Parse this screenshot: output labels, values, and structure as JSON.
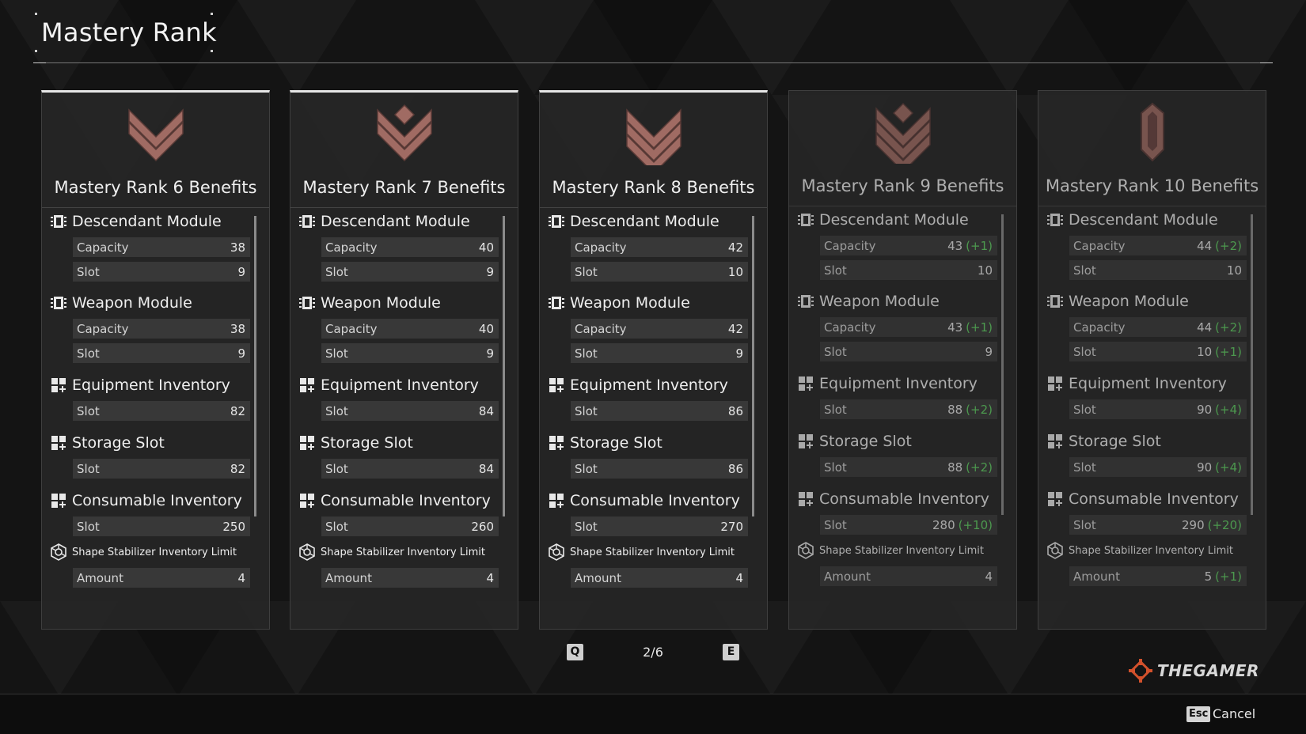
{
  "page": {
    "title": "Mastery Rank",
    "colors": {
      "background": "#141414",
      "card": "#262626",
      "stat_row": "#383838",
      "bonus_green": "#5fcf62",
      "emblem_copper": "#a06b63"
    }
  },
  "cards": [
    {
      "title": "Mastery Rank 6 Benefits",
      "emblem": "rank-6-chevron-emblem",
      "current": true,
      "locked": false,
      "sections": [
        {
          "title": "Descendant Module",
          "icon": "module-icon",
          "rows": [
            {
              "label": "Capacity",
              "value": "38",
              "bonus": ""
            },
            {
              "label": "Slot",
              "value": "9",
              "bonus": ""
            }
          ]
        },
        {
          "title": "Weapon Module",
          "icon": "module-icon",
          "rows": [
            {
              "label": "Capacity",
              "value": "38",
              "bonus": ""
            },
            {
              "label": "Slot",
              "value": "9",
              "bonus": ""
            }
          ]
        },
        {
          "title": "Equipment Inventory",
          "icon": "inventory-icon",
          "rows": [
            {
              "label": "Slot",
              "value": "82",
              "bonus": ""
            }
          ]
        },
        {
          "title": "Storage Slot",
          "icon": "inventory-icon",
          "rows": [
            {
              "label": "Slot",
              "value": "82",
              "bonus": ""
            }
          ]
        },
        {
          "title": "Consumable Inventory",
          "icon": "inventory-icon",
          "rows": [
            {
              "label": "Slot",
              "value": "250",
              "bonus": ""
            }
          ]
        },
        {
          "title": "Shape Stabilizer Inventory Limit",
          "icon": "stabilizer-icon",
          "rows": [
            {
              "label": "Amount",
              "value": "4",
              "bonus": ""
            }
          ]
        }
      ]
    },
    {
      "title": "Mastery Rank 7 Benefits",
      "emblem": "rank-7-chevron-emblem",
      "current": true,
      "locked": false,
      "sections": [
        {
          "title": "Descendant Module",
          "icon": "module-icon",
          "rows": [
            {
              "label": "Capacity",
              "value": "40",
              "bonus": ""
            },
            {
              "label": "Slot",
              "value": "9",
              "bonus": ""
            }
          ]
        },
        {
          "title": "Weapon Module",
          "icon": "module-icon",
          "rows": [
            {
              "label": "Capacity",
              "value": "40",
              "bonus": ""
            },
            {
              "label": "Slot",
              "value": "9",
              "bonus": ""
            }
          ]
        },
        {
          "title": "Equipment Inventory",
          "icon": "inventory-icon",
          "rows": [
            {
              "label": "Slot",
              "value": "84",
              "bonus": ""
            }
          ]
        },
        {
          "title": "Storage Slot",
          "icon": "inventory-icon",
          "rows": [
            {
              "label": "Slot",
              "value": "84",
              "bonus": ""
            }
          ]
        },
        {
          "title": "Consumable Inventory",
          "icon": "inventory-icon",
          "rows": [
            {
              "label": "Slot",
              "value": "260",
              "bonus": ""
            }
          ]
        },
        {
          "title": "Shape Stabilizer Inventory Limit",
          "icon": "stabilizer-icon",
          "rows": [
            {
              "label": "Amount",
              "value": "4",
              "bonus": ""
            }
          ]
        }
      ]
    },
    {
      "title": "Mastery Rank 8 Benefits",
      "emblem": "rank-8-chevron-emblem",
      "current": true,
      "locked": false,
      "sections": [
        {
          "title": "Descendant Module",
          "icon": "module-icon",
          "rows": [
            {
              "label": "Capacity",
              "value": "42",
              "bonus": ""
            },
            {
              "label": "Slot",
              "value": "10",
              "bonus": ""
            }
          ]
        },
        {
          "title": "Weapon Module",
          "icon": "module-icon",
          "rows": [
            {
              "label": "Capacity",
              "value": "42",
              "bonus": ""
            },
            {
              "label": "Slot",
              "value": "9",
              "bonus": ""
            }
          ]
        },
        {
          "title": "Equipment Inventory",
          "icon": "inventory-icon",
          "rows": [
            {
              "label": "Slot",
              "value": "86",
              "bonus": ""
            }
          ]
        },
        {
          "title": "Storage Slot",
          "icon": "inventory-icon",
          "rows": [
            {
              "label": "Slot",
              "value": "86",
              "bonus": ""
            }
          ]
        },
        {
          "title": "Consumable Inventory",
          "icon": "inventory-icon",
          "rows": [
            {
              "label": "Slot",
              "value": "270",
              "bonus": ""
            }
          ]
        },
        {
          "title": "Shape Stabilizer Inventory Limit",
          "icon": "stabilizer-icon",
          "rows": [
            {
              "label": "Amount",
              "value": "4",
              "bonus": ""
            }
          ]
        }
      ]
    },
    {
      "title": "Mastery Rank 9 Benefits",
      "emblem": "rank-9-chevron-emblem",
      "current": false,
      "locked": true,
      "sections": [
        {
          "title": "Descendant Module",
          "icon": "module-icon",
          "rows": [
            {
              "label": "Capacity",
              "value": "43",
              "bonus": "(+1)"
            },
            {
              "label": "Slot",
              "value": "10",
              "bonus": ""
            }
          ]
        },
        {
          "title": "Weapon Module",
          "icon": "module-icon",
          "rows": [
            {
              "label": "Capacity",
              "value": "43",
              "bonus": "(+1)"
            },
            {
              "label": "Slot",
              "value": "9",
              "bonus": ""
            }
          ]
        },
        {
          "title": "Equipment Inventory",
          "icon": "inventory-icon",
          "rows": [
            {
              "label": "Slot",
              "value": "88",
              "bonus": "(+2)"
            }
          ]
        },
        {
          "title": "Storage Slot",
          "icon": "inventory-icon",
          "rows": [
            {
              "label": "Slot",
              "value": "88",
              "bonus": "(+2)"
            }
          ]
        },
        {
          "title": "Consumable Inventory",
          "icon": "inventory-icon",
          "rows": [
            {
              "label": "Slot",
              "value": "280",
              "bonus": "(+10)"
            }
          ]
        },
        {
          "title": "Shape Stabilizer Inventory Limit",
          "icon": "stabilizer-icon",
          "rows": [
            {
              "label": "Amount",
              "value": "4",
              "bonus": ""
            }
          ]
        }
      ]
    },
    {
      "title": "Mastery Rank 10 Benefits",
      "emblem": "rank-10-crystal-emblem",
      "current": false,
      "locked": true,
      "sections": [
        {
          "title": "Descendant Module",
          "icon": "module-icon",
          "rows": [
            {
              "label": "Capacity",
              "value": "44",
              "bonus": "(+2)"
            },
            {
              "label": "Slot",
              "value": "10",
              "bonus": ""
            }
          ]
        },
        {
          "title": "Weapon Module",
          "icon": "module-icon",
          "rows": [
            {
              "label": "Capacity",
              "value": "44",
              "bonus": "(+2)"
            },
            {
              "label": "Slot",
              "value": "10",
              "bonus": "(+1)"
            }
          ]
        },
        {
          "title": "Equipment Inventory",
          "icon": "inventory-icon",
          "rows": [
            {
              "label": "Slot",
              "value": "90",
              "bonus": "(+4)"
            }
          ]
        },
        {
          "title": "Storage Slot",
          "icon": "inventory-icon",
          "rows": [
            {
              "label": "Slot",
              "value": "90",
              "bonus": "(+4)"
            }
          ]
        },
        {
          "title": "Consumable Inventory",
          "icon": "inventory-icon",
          "rows": [
            {
              "label": "Slot",
              "value": "290",
              "bonus": "(+20)"
            }
          ]
        },
        {
          "title": "Shape Stabilizer Inventory Limit",
          "icon": "stabilizer-icon",
          "rows": [
            {
              "label": "Amount",
              "value": "5",
              "bonus": "(+1)"
            }
          ]
        }
      ]
    }
  ],
  "pager": {
    "prev_key": "Q",
    "next_key": "E",
    "page": "2/6"
  },
  "watermark": {
    "text": "THEGAMER",
    "icon": "thegamer-logo-icon"
  },
  "footer": {
    "esc_key": "Esc",
    "cancel_label": "Cancel"
  }
}
